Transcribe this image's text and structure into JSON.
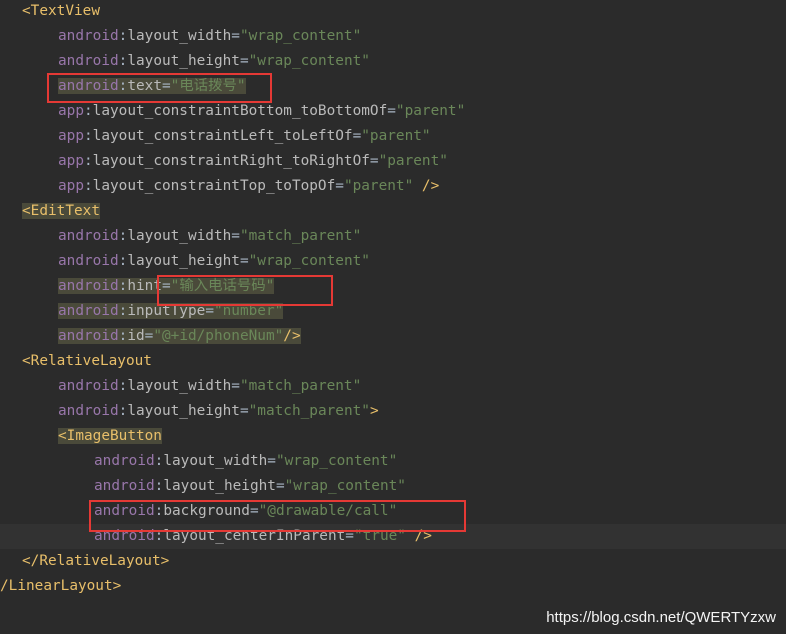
{
  "lines": [
    {
      "indent": 22,
      "parts": [
        [
          "punct",
          "<"
        ],
        [
          "tag",
          "TextView"
        ]
      ]
    },
    {
      "indent": 58,
      "parts": [
        [
          "ns",
          "android"
        ],
        [
          "eq",
          ":"
        ],
        [
          "attr",
          "layout_width"
        ],
        [
          "eq",
          "="
        ],
        [
          "val",
          "\"wrap_content\""
        ]
      ]
    },
    {
      "indent": 58,
      "parts": [
        [
          "ns",
          "android"
        ],
        [
          "eq",
          ":"
        ],
        [
          "attr",
          "layout_height"
        ],
        [
          "eq",
          "="
        ],
        [
          "val",
          "\"wrap_content\""
        ]
      ]
    },
    {
      "indent": 58,
      "parts": [
        [
          "ns",
          "android"
        ],
        [
          "eq",
          ":"
        ],
        [
          "attr",
          "text"
        ],
        [
          "eq",
          "="
        ],
        [
          "val",
          "\"电话拨号\""
        ]
      ],
      "highlight": true
    },
    {
      "indent": 58,
      "parts": [
        [
          "ns",
          "app"
        ],
        [
          "eq",
          ":"
        ],
        [
          "attr",
          "layout_constraintBottom_toBottomOf"
        ],
        [
          "eq",
          "="
        ],
        [
          "val",
          "\"parent\""
        ]
      ]
    },
    {
      "indent": 58,
      "parts": [
        [
          "ns",
          "app"
        ],
        [
          "eq",
          ":"
        ],
        [
          "attr",
          "layout_constraintLeft_toLeftOf"
        ],
        [
          "eq",
          "="
        ],
        [
          "val",
          "\"parent\""
        ]
      ]
    },
    {
      "indent": 58,
      "parts": [
        [
          "ns",
          "app"
        ],
        [
          "eq",
          ":"
        ],
        [
          "attr",
          "layout_constraintRight_toRightOf"
        ],
        [
          "eq",
          "="
        ],
        [
          "val",
          "\"parent\""
        ]
      ]
    },
    {
      "indent": 58,
      "parts": [
        [
          "ns",
          "app"
        ],
        [
          "eq",
          ":"
        ],
        [
          "attr",
          "layout_constraintTop_toTopOf"
        ],
        [
          "eq",
          "="
        ],
        [
          "val",
          "\"parent\""
        ],
        [
          "eq",
          " "
        ],
        [
          "punct",
          "/>"
        ]
      ]
    },
    {
      "indent": 22,
      "parts": [
        [
          "punct",
          "<"
        ],
        [
          "tag",
          "EditText"
        ]
      ],
      "highlight": true
    },
    {
      "indent": 58,
      "parts": [
        [
          "ns",
          "android"
        ],
        [
          "eq",
          ":"
        ],
        [
          "attr",
          "layout_width"
        ],
        [
          "eq",
          "="
        ],
        [
          "val",
          "\"match_parent\""
        ]
      ]
    },
    {
      "indent": 58,
      "parts": [
        [
          "ns",
          "android"
        ],
        [
          "eq",
          ":"
        ],
        [
          "attr",
          "layout_height"
        ],
        [
          "eq",
          "="
        ],
        [
          "val",
          "\"wrap_content\""
        ]
      ]
    },
    {
      "indent": 58,
      "parts": [
        [
          "ns",
          "android"
        ],
        [
          "eq",
          ":"
        ],
        [
          "attr",
          "hint"
        ],
        [
          "eq",
          "="
        ],
        [
          "val",
          "\"输入电话号码\""
        ]
      ],
      "highlight": true
    },
    {
      "indent": 58,
      "parts": [
        [
          "ns",
          "android"
        ],
        [
          "eq",
          ":"
        ],
        [
          "attr",
          "inputType"
        ],
        [
          "eq",
          "="
        ],
        [
          "val",
          "\"number\""
        ]
      ],
      "highlight": true
    },
    {
      "indent": 58,
      "parts": [
        [
          "ns",
          "android"
        ],
        [
          "eq",
          ":"
        ],
        [
          "attr",
          "id"
        ],
        [
          "eq",
          "="
        ],
        [
          "val",
          "\"@+id/phoneNum\""
        ],
        [
          "punct",
          "/>"
        ]
      ],
      "highlight": true
    },
    {
      "indent": 22,
      "parts": [
        [
          "punct",
          "<"
        ],
        [
          "tag",
          "RelativeLayout"
        ]
      ]
    },
    {
      "indent": 58,
      "parts": [
        [
          "ns",
          "android"
        ],
        [
          "eq",
          ":"
        ],
        [
          "attr",
          "layout_width"
        ],
        [
          "eq",
          "="
        ],
        [
          "val",
          "\"match_parent\""
        ]
      ]
    },
    {
      "indent": 58,
      "parts": [
        [
          "ns",
          "android"
        ],
        [
          "eq",
          ":"
        ],
        [
          "attr",
          "layout_height"
        ],
        [
          "eq",
          "="
        ],
        [
          "val",
          "\"match_parent\""
        ],
        [
          "punct",
          ">"
        ]
      ]
    },
    {
      "indent": 58,
      "parts": [
        [
          "punct",
          "<"
        ],
        [
          "tag",
          "ImageButton"
        ]
      ],
      "highlight": true
    },
    {
      "indent": 94,
      "parts": [
        [
          "ns",
          "android"
        ],
        [
          "eq",
          ":"
        ],
        [
          "attr",
          "layout_width"
        ],
        [
          "eq",
          "="
        ],
        [
          "val",
          "\"wrap_content\""
        ]
      ]
    },
    {
      "indent": 94,
      "parts": [
        [
          "ns",
          "android"
        ],
        [
          "eq",
          ":"
        ],
        [
          "attr",
          "layout_height"
        ],
        [
          "eq",
          "="
        ],
        [
          "val",
          "\"wrap_content\""
        ]
      ]
    },
    {
      "indent": 94,
      "parts": [
        [
          "ns",
          "android"
        ],
        [
          "eq",
          ":"
        ],
        [
          "attr",
          "background"
        ],
        [
          "eq",
          "="
        ],
        [
          "val",
          "\"@drawable/call\""
        ]
      ]
    },
    {
      "indent": 94,
      "parts": [
        [
          "ns",
          "android"
        ],
        [
          "eq",
          ":"
        ],
        [
          "attr",
          "layout_centerInParent"
        ],
        [
          "eq",
          "="
        ],
        [
          "val",
          "\"true\""
        ],
        [
          "eq",
          " "
        ],
        [
          "punct",
          "/>"
        ]
      ],
      "caret": true
    },
    {
      "indent": 22,
      "parts": [
        [
          "punct",
          "</"
        ],
        [
          "tag",
          "RelativeLayout"
        ],
        [
          "punct",
          ">"
        ]
      ]
    },
    {
      "indent": 0,
      "parts": [
        [
          "punct",
          "/"
        ],
        [
          "tag",
          "LinearLayout"
        ],
        [
          "punct",
          ">"
        ]
      ]
    }
  ],
  "watermark": "https://blog.csdn.net/QWERTYzxw"
}
